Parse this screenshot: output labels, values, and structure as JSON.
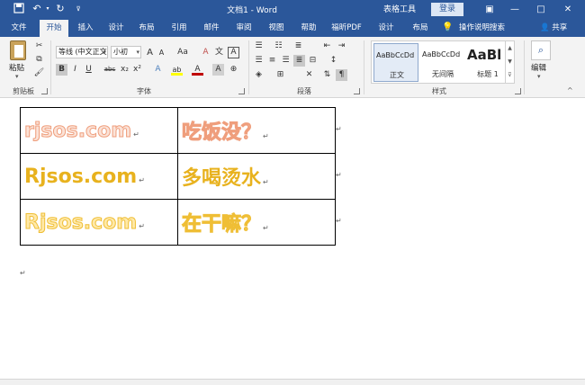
{
  "titlebar": {
    "doc_title": "文档1  -  Word",
    "context_group": "表格工具",
    "login": "登录",
    "save_icon": "save-icon",
    "undo_icon": "undo-icon",
    "redo_icon": "redo-icon",
    "customize_icon": "customize-icon"
  },
  "tabs": {
    "file": "文件",
    "home": "开始",
    "insert": "插入",
    "design": "设计",
    "layout": "布局",
    "references": "引用",
    "mailings": "邮件",
    "review": "审阅",
    "view": "视图",
    "help": "帮助",
    "pdf": "福昕PDF",
    "table_design": "设计",
    "table_layout": "布局",
    "tell_me": "操作说明搜索",
    "share": "共享"
  },
  "ribbon": {
    "clipboard": {
      "paste": "粘贴",
      "label": "剪贴板"
    },
    "font": {
      "font_name": "等线 (中文正文",
      "font_size": "小初",
      "label": "字体",
      "grow": "A",
      "shrink": "A",
      "case": "Aa",
      "bold": "B",
      "italic": "I",
      "underline": "U",
      "strike": "abc",
      "subscript": "x₂",
      "superscript": "x²",
      "clear": "A",
      "text_effects": "A",
      "highlight": "ab",
      "font_color": "A",
      "char_shading": "A",
      "char_border": "A"
    },
    "paragraph": {
      "label": "段落"
    },
    "styles": {
      "label": "样式",
      "items": [
        {
          "preview": "AaBbCcDd",
          "name": "正文"
        },
        {
          "preview": "AaBbCcDd",
          "name": "无间隔"
        },
        {
          "preview": "AaBl",
          "name": "标题 1"
        }
      ]
    },
    "editing": {
      "label": "编辑"
    }
  },
  "document": {
    "table": [
      [
        "rjsos.com",
        "吃饭没？"
      ],
      [
        "Rjsos.com",
        "多喝烫水"
      ],
      [
        "Rjsos.com",
        "在干嘛？"
      ]
    ],
    "paragraph_mark": "↵"
  },
  "colors": {
    "title_blue": "#2b579a",
    "row1_fill": "#fbe3d8",
    "row1_outline": "#ef9e7c",
    "row2_fill": "#e8b21e",
    "row3_fill": "#ffe9a8",
    "row3_outline": "#efbe35"
  }
}
